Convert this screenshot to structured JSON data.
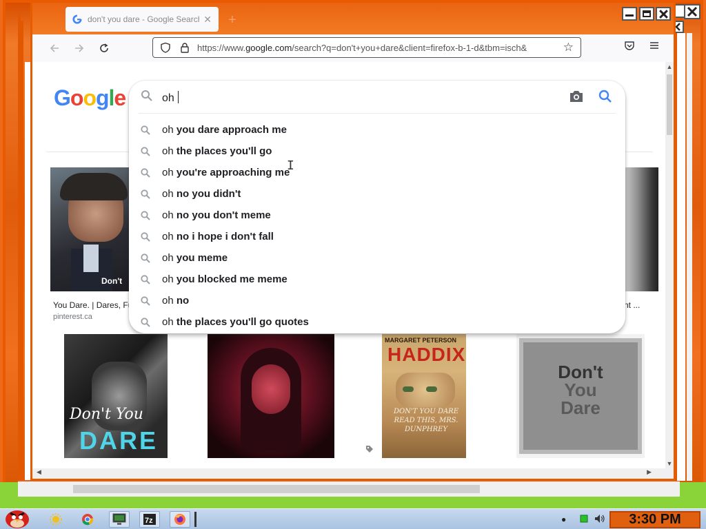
{
  "browser": {
    "tab_title": "don't you dare - Google Search",
    "url_prefix": "https://www.",
    "url_domain": "google.com",
    "url_rest": "/search?q=don't+you+dare&client=firefox-b-1-d&tbm=isch&"
  },
  "google": {
    "logo_letters": [
      "G",
      "o",
      "o",
      "g",
      "l",
      "e"
    ],
    "logo_colors": [
      "#4285f4",
      "#ea4335",
      "#fbbc05",
      "#4285f4",
      "#34a853",
      "#ea4335"
    ]
  },
  "search": {
    "query": "oh "
  },
  "suggestions": [
    {
      "prefix": "oh",
      "bold": "you dare approach me"
    },
    {
      "prefix": "oh",
      "bold": "the places you'll go"
    },
    {
      "prefix": "oh",
      "bold": "you're approaching me"
    },
    {
      "prefix": "oh",
      "bold": "no you didn't"
    },
    {
      "prefix": "oh",
      "bold": "no you don't meme"
    },
    {
      "prefix": "oh",
      "bold": "no i hope i don't fall"
    },
    {
      "prefix": "oh",
      "bold": "you meme"
    },
    {
      "prefix": "oh",
      "bold": "you blocked me meme"
    },
    {
      "prefix": "oh",
      "bold": "no"
    },
    {
      "prefix": "oh",
      "bold": "the places you'll go quotes"
    }
  ],
  "results": {
    "r1_caption": "You Dare. | Dares, Fu",
    "r1_source": "pinterest.ca",
    "r1_overlay": "Don't",
    "r_right_caption": "nt ...",
    "book1_title_a": "Don't You",
    "book1_title_b": "DARE",
    "book3_author_a": "MARGARET PETERSON",
    "book3_author_b": "HADDIX",
    "book3_sub": "DON'T YOU DARE READ THIS, MRS. DUNPHREY",
    "book4_line1": "Don't",
    "book4_line2": "You",
    "book4_line3": "Dare"
  },
  "taskbar": {
    "clock": "3:30 PM"
  }
}
